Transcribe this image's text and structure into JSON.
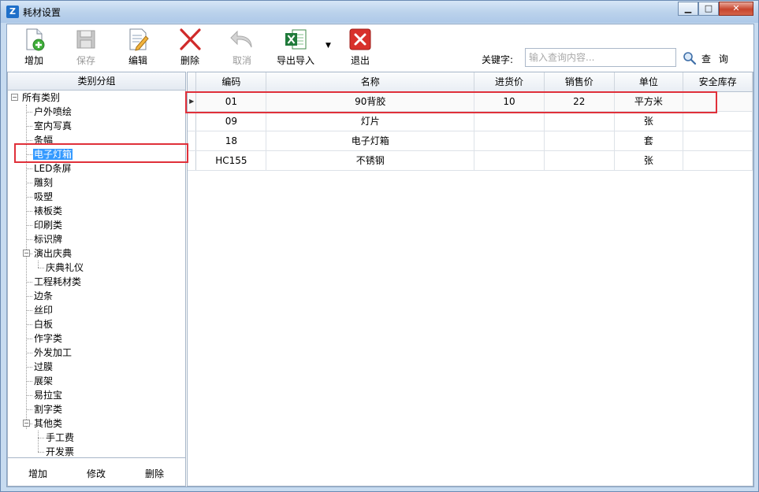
{
  "window": {
    "title": "耗材设置",
    "app_icon": "Z",
    "minimize": "▁",
    "maximize": "□",
    "close": "✕"
  },
  "toolbar": {
    "add": "增加",
    "save": "保存",
    "edit": "编辑",
    "delete": "删除",
    "cancel": "取消",
    "export_import": "导出导入",
    "exit": "退出"
  },
  "search": {
    "label": "关键字:",
    "placeholder": "输入查询内容...",
    "button": "查 询"
  },
  "category_panel": {
    "header": "类别分组",
    "root": "所有类别",
    "items": [
      "户外喷绘",
      "室内写真",
      "条幅",
      "电子灯箱",
      "LED条屏",
      "雕刻",
      "吸塑",
      "裱板类",
      "印刷类",
      "标识牌",
      "演出庆典",
      "庆典礼仪",
      "工程耗材类",
      "边条",
      "丝印",
      "白板",
      "作字类",
      "外发加工",
      "过膜",
      "展架",
      "易拉宝",
      "割字类",
      "其他类",
      "手工费",
      "开发票"
    ],
    "selected": "电子灯箱",
    "footer": {
      "add": "增加",
      "modify": "修改",
      "delete": "删除"
    }
  },
  "table": {
    "columns": [
      "编码",
      "名称",
      "进货价",
      "销售价",
      "单位",
      "安全库存"
    ],
    "rows": [
      [
        "01",
        "90背胶",
        "10",
        "22",
        "平方米",
        ""
      ],
      [
        "09",
        "灯片",
        "",
        "",
        "张",
        ""
      ],
      [
        "18",
        "电子灯箱",
        "",
        "",
        "套",
        ""
      ],
      [
        "HC155",
        "不锈钢",
        "",
        "",
        "张",
        ""
      ]
    ],
    "row_pointer": "▶"
  },
  "colors": {
    "highlight_red": "#e0303a",
    "selection_blue": "#3399ff",
    "titlebar": "#bcd3ec"
  },
  "icons": [
    "new-document-icon",
    "save-disk-icon",
    "edit-document-icon",
    "delete-x-icon",
    "undo-arrow-icon",
    "excel-icon",
    "exit-icon",
    "search-magnifier-icon"
  ]
}
